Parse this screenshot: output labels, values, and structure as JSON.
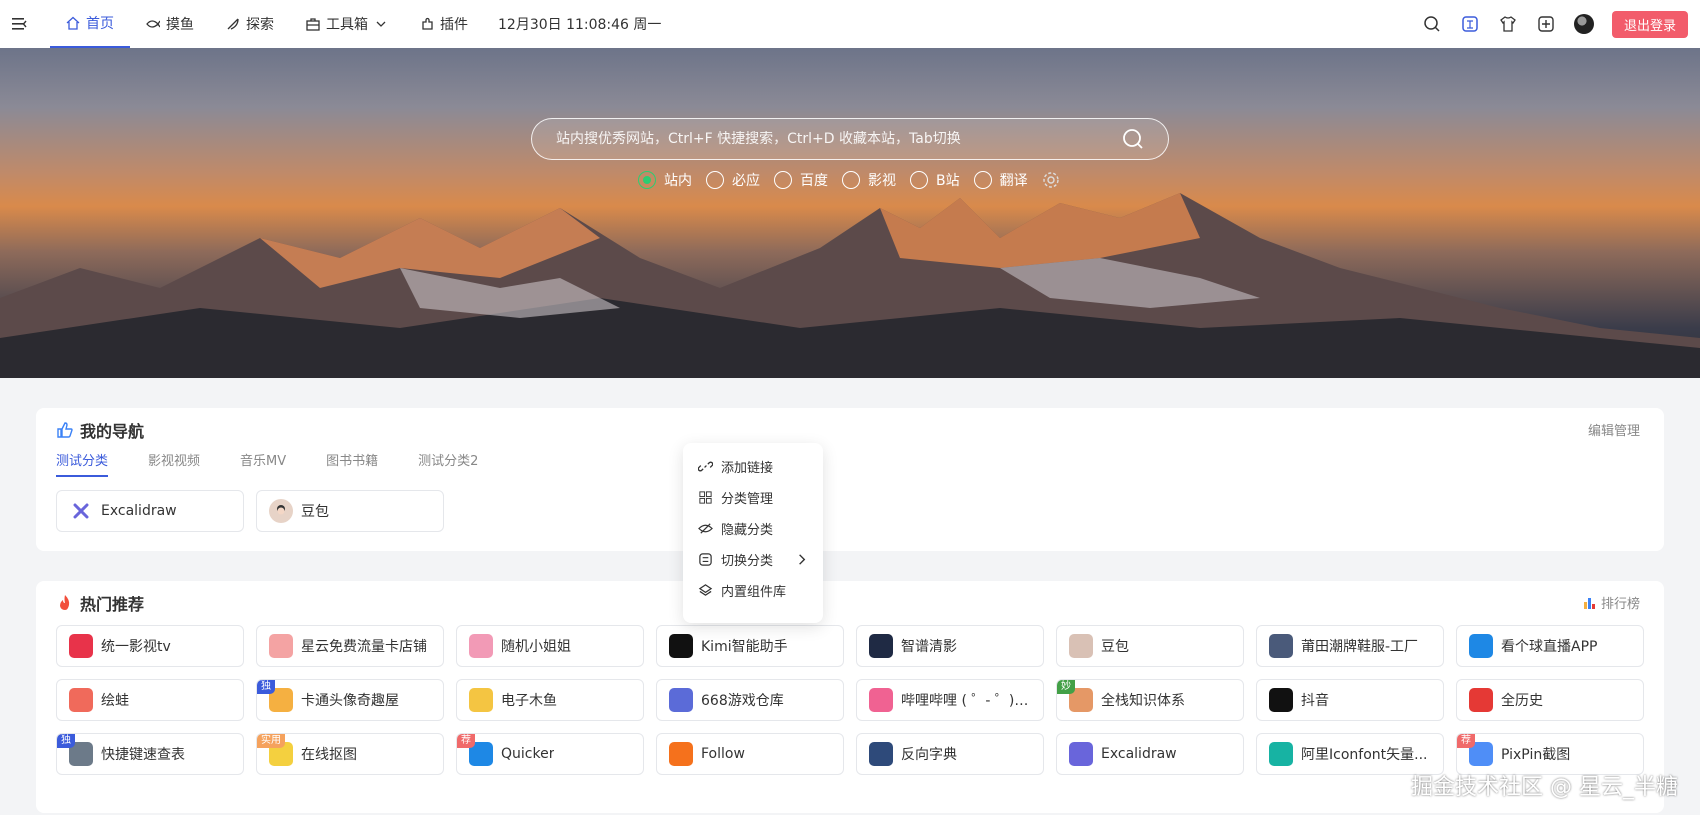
{
  "topbar": {
    "nav": [
      {
        "label": "首页",
        "icon": "home-icon",
        "active": true
      },
      {
        "label": "摸鱼",
        "icon": "fish-icon"
      },
      {
        "label": "探索",
        "icon": "explore-icon"
      },
      {
        "label": "工具箱",
        "icon": "toolbox-icon"
      },
      {
        "label": "插件",
        "icon": "plugin-icon"
      }
    ],
    "clock": "12月30日 11:08:46 周一",
    "logout_label": "退出登录"
  },
  "search": {
    "placeholder": "站内搜优秀网站，Ctrl+F 快捷搜索，Ctrl+D 收藏本站，Tab切换",
    "engines": [
      "站内",
      "必应",
      "百度",
      "影视",
      "B站",
      "翻译"
    ],
    "selected": "站内"
  },
  "my_nav": {
    "title": "我的导航",
    "action": "编辑管理",
    "tabs": [
      "测试分类",
      "影视视频",
      "音乐MV",
      "图书书籍",
      "测试分类2"
    ],
    "links": [
      "Excalidraw",
      "豆包"
    ]
  },
  "context_menu": {
    "items": [
      "添加链接",
      "分类管理",
      "隐藏分类",
      "切换分类",
      "内置组件库"
    ]
  },
  "hot": {
    "title": "热门推荐",
    "action": "排行榜",
    "links": [
      {
        "label": "统一影视tv",
        "color": "#e8334a"
      },
      {
        "label": "星云免费流量卡店铺",
        "color": "#f4a3a3"
      },
      {
        "label": "随机小姐姐",
        "color": "#f29ab6"
      },
      {
        "label": "Kimi智能助手",
        "color": "#111111"
      },
      {
        "label": "智谱清影",
        "color": "#1f2a44"
      },
      {
        "label": "豆包",
        "color": "#d9c1b5"
      },
      {
        "label": "莆田潮牌鞋服-工厂",
        "color": "#4a5a7a"
      },
      {
        "label": "看个球直播APP",
        "color": "#1e88e5"
      },
      {
        "label": "绘蛙",
        "color": "#f06a5b"
      },
      {
        "label": "卡通头像奇趣屋",
        "color": "#f5b041",
        "badge": "独"
      },
      {
        "label": "电子木鱼",
        "color": "#f4c542"
      },
      {
        "label": "668游戏仓库",
        "color": "#5b6bd8"
      },
      {
        "label": "哔哩哔哩 ( ゜- ゜)つ...",
        "color": "#f06292"
      },
      {
        "label": "全栈知识体系",
        "color": "#e59866",
        "badge": "妙"
      },
      {
        "label": "抖音",
        "color": "#111111"
      },
      {
        "label": "全历史",
        "color": "#e53935"
      },
      {
        "label": "快捷键速查表",
        "color": "#6c7a89",
        "badge": "独"
      },
      {
        "label": "在线抠图",
        "color": "#f4d03f",
        "badge": "实用"
      },
      {
        "label": "Quicker",
        "color": "#1e88e5",
        "badge": "荐"
      },
      {
        "label": "Follow",
        "color": "#f5711c"
      },
      {
        "label": "反向字典",
        "color": "#2e4a7a"
      },
      {
        "label": "Excalidraw",
        "color": "#6965db"
      },
      {
        "label": "阿里Iconfont矢量...",
        "color": "#17b3a3"
      },
      {
        "label": "PixPin截图",
        "color": "#4f8ef7",
        "badge": "荐"
      }
    ]
  },
  "watermark": "掘金技术社区 @ 星云_半糖"
}
